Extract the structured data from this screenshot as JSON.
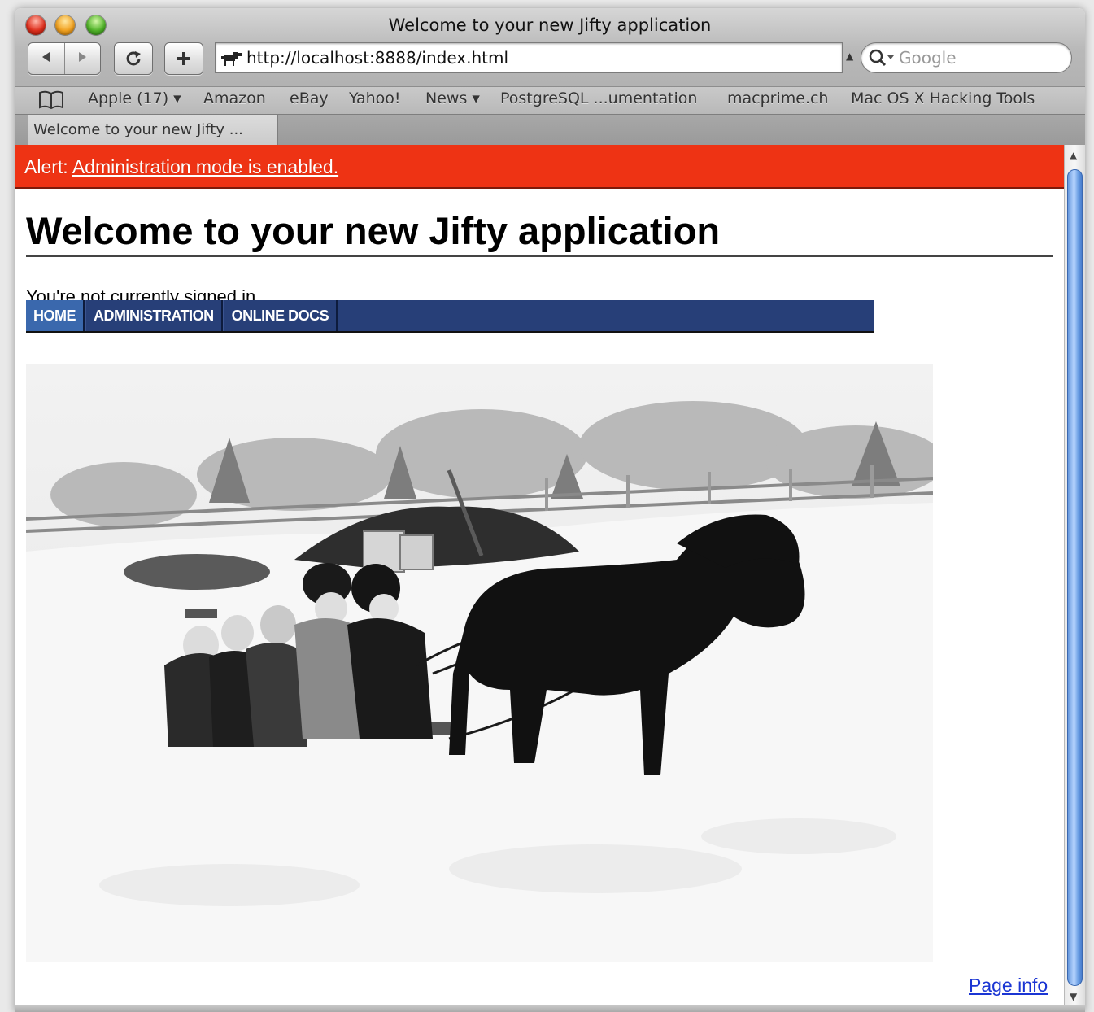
{
  "browser": {
    "window_title": "Welcome to your new Jifty application",
    "url": "http://localhost:8888/index.html",
    "search_placeholder": "Google",
    "tab_label": "Welcome to your new Jifty ...",
    "nav_back_icon": "back-arrow-icon",
    "nav_forward_icon": "forward-arrow-icon",
    "reload_icon": "reload-icon",
    "add_icon": "plus-icon",
    "bookmarks": [
      "Apple (17) ▾",
      "Amazon",
      "eBay",
      "Yahoo!",
      "News ▾",
      "PostgreSQL ...umentation",
      "macprime.ch",
      "Mac OS X Hacking Tools"
    ]
  },
  "page": {
    "alert_prefix": "Alert:",
    "alert_link": "Administration mode is enabled.",
    "title": "Welcome to your new Jifty application",
    "signin_status": "You're not currently signed in.",
    "nav": [
      "Home",
      "Administration",
      "Online Docs"
    ],
    "image_alt": "Vintage photo of children on a sled pulled by a pony in snow",
    "page_info": "Page info"
  },
  "colors": {
    "alert_bg": "#ee3314",
    "nav_bg": "#273f78",
    "nav_active": "#3a68ad",
    "link": "#1a35d3"
  }
}
